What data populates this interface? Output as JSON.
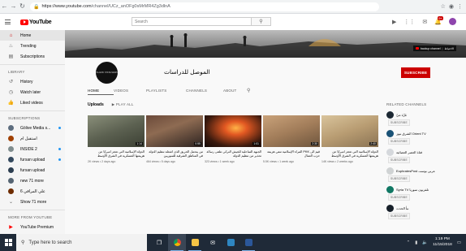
{
  "browser": {
    "url_host": "https://www.youtube.com",
    "url_path": "/channel/UCz_anOFg0sMrMR4Zg3dlnA",
    "back_icon": "arrow-left-icon",
    "forward_icon": "arrow-right-icon",
    "reload_icon": "reload-icon"
  },
  "header": {
    "logo_text": "YouTube",
    "search_placeholder": "Search",
    "notification_count": "9+",
    "avatar_color": "#8e44ad"
  },
  "sidebar": {
    "main": [
      {
        "label": "Home",
        "icon": "home-icon",
        "glyph": "⌂",
        "active": true
      },
      {
        "label": "Trending",
        "icon": "flame-icon",
        "glyph": "♨"
      },
      {
        "label": "Subscriptions",
        "icon": "subscriptions-icon",
        "glyph": "▤"
      }
    ],
    "library_title": "LIBRARY",
    "library": [
      {
        "label": "History",
        "icon": "history-icon",
        "glyph": "↺"
      },
      {
        "label": "Watch later",
        "icon": "clock-icon",
        "glyph": "◷"
      },
      {
        "label": "Liked videos",
        "icon": "thumb-up-icon",
        "glyph": "👍"
      }
    ],
    "subs_title": "SUBSCRIPTIONS",
    "subscriptions": [
      {
        "label": "Gölive Media s...",
        "color": "#5d6d7e",
        "dot": true
      },
      {
        "label": "استقبل ام",
        "color": "#a04000"
      },
      {
        "label": "INSIDE 2",
        "color": "#7f8c8d",
        "dot": true
      },
      {
        "label": "fursan upload",
        "color": "#34495e",
        "dot": true
      },
      {
        "label": "fursan upload",
        "color": "#2c3e50"
      },
      {
        "label": "new 71 more",
        "color": "#566573"
      },
      {
        "label": "علي المراقي 6",
        "color": "#6e2c00"
      }
    ],
    "show_more": "Show 71 more",
    "more_title": "MORE FROM YOUTUBE",
    "more": [
      {
        "label": "YouTube Premium",
        "icon": "youtube-icon"
      }
    ]
  },
  "banner": {
    "badge_text": "backup channel",
    "badge_text2": "الاحتياط"
  },
  "channel": {
    "name": "الموصل للدراسات",
    "avatar_text": "ISLAMIC STATE NEWS",
    "subscribe_label": "SUBSCRIBE",
    "tabs": [
      "HOME",
      "VIDEOS",
      "PLAYLISTS",
      "CHANNELS",
      "ABOUT"
    ]
  },
  "uploads": {
    "title": "Uploads",
    "play_all": "PLAY ALL",
    "videos": [
      {
        "title": "الدولة الإسلامية التي تعجز أميركا عن هزيمتها العسكرية في الشرق الأوسط",
        "duration": "1:14",
        "meta": "2K views • 2 days ago"
      },
      {
        "title": "من يتحمل الحريق الذي أشعله تنظيم الدولة في المناطق الشرقية للسوريين",
        "duration": "0:55",
        "meta": "464 views • 5 days ago"
      },
      {
        "title": "الجبهة الساحلية للجيش التركي تتلقى رسالة تحذير من تنظيم الدولة",
        "duration": "1:01",
        "meta": "323 views • 1 week ago"
      },
      {
        "title": "قيم الى PKK المرأة الإسلامية تنفي هزيمة حزب العمال",
        "duration": "2:30",
        "meta": "5.5K views • 1 week ago"
      },
      {
        "title": "الدولة الإسلامية التي تعجز أميركا عن هزيمتها العسكرية في الشرق الأوسط",
        "duration": "2:40",
        "meta": "14K views • 2 weeks ago"
      }
    ]
  },
  "related": {
    "title": "RELATED CHANNELS",
    "subscribe_label": "SUBSCRIBE",
    "channels": [
      {
        "name": "عَزّة ميّ",
        "color": "#1c2833"
      },
      {
        "name": "الشرق نيوز Orient TV",
        "color": "#1a5276"
      },
      {
        "name": "قناة العصر العصائية",
        "color": "#d5d8dc"
      },
      {
        "name": "EuphratesPost عربي بوست",
        "color": "#d0d3d4"
      },
      {
        "name": "Syria TV تلفزيون سوريا",
        "color": "#117864"
      },
      {
        "name": "نبأ الحدث",
        "color": "#17202a"
      }
    ]
  },
  "taskbar": {
    "search_placeholder": "Type here to search",
    "time": "1:19 PM",
    "date": "11/15/2018"
  }
}
